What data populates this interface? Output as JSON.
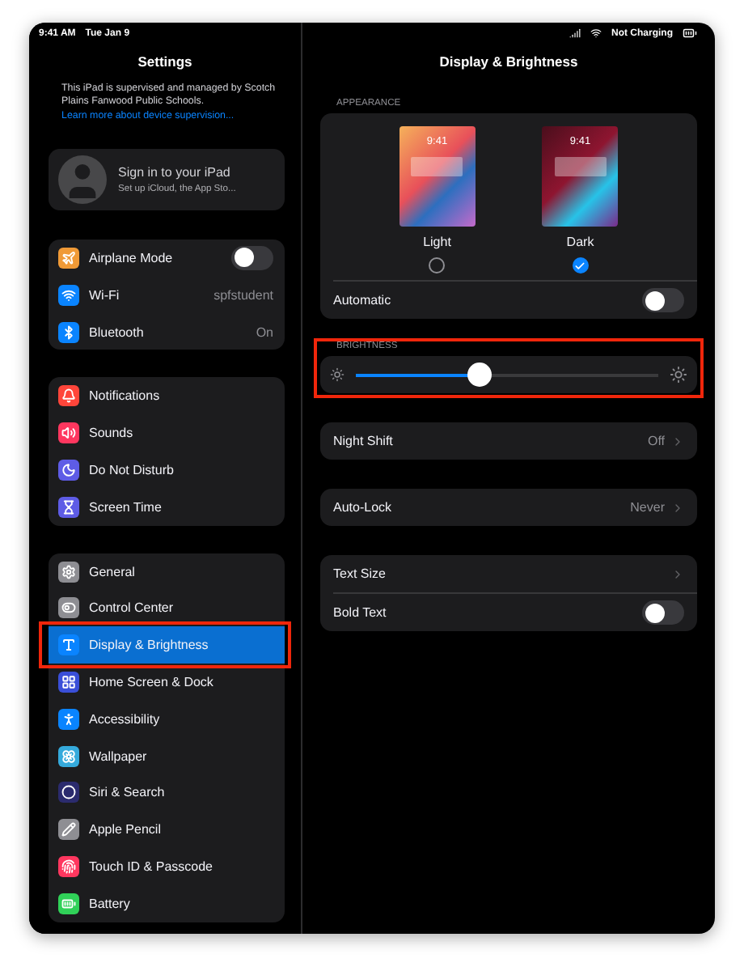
{
  "sidebar": {
    "status": {
      "time": "9:41 AM",
      "date": "Tue Jan 9"
    },
    "title": "Settings",
    "notice": "This iPad is supervised and managed by Scotch Plains Fanwood Public Schools.",
    "notice_link": "Learn more about device supervision...",
    "profile": {
      "title": "Sign in to your iPad",
      "subtitle": "Set up iCloud, the App Sto..."
    },
    "groups": [
      {
        "items": [
          {
            "label": "Airplane Mode",
            "kind": "toggle",
            "on": false,
            "selected": false,
            "highlighted": false,
            "color": "#f09a37"
          },
          {
            "label": "Wi-Fi",
            "kind": "value",
            "value": "spfstudent",
            "selected": false,
            "highlighted": false,
            "color": "#0a84ff"
          },
          {
            "label": "Bluetooth",
            "kind": "value",
            "value": "On",
            "selected": false,
            "highlighted": false,
            "color": "#0a84ff"
          }
        ]
      },
      {
        "items": [
          {
            "label": "Notifications",
            "kind": "plain",
            "selected": false,
            "highlighted": false,
            "color": "#ff453a"
          },
          {
            "label": "Sounds",
            "kind": "plain",
            "selected": false,
            "highlighted": false,
            "color": "#ff375f"
          },
          {
            "label": "Do Not Disturb",
            "kind": "plain",
            "selected": false,
            "highlighted": false,
            "color": "#5e5ce6"
          },
          {
            "label": "Screen Time",
            "kind": "plain",
            "selected": false,
            "highlighted": false,
            "color": "#5e5ce6"
          }
        ]
      },
      {
        "items": [
          {
            "label": "General",
            "kind": "plain",
            "selected": false,
            "highlighted": false,
            "color": "#8e8e93"
          },
          {
            "label": "Control Center",
            "kind": "plain",
            "selected": false,
            "highlighted": false,
            "color": "#8e8e93"
          },
          {
            "label": "Display & Brightness",
            "kind": "plain",
            "selected": true,
            "highlighted": true,
            "color": "#0a84ff"
          },
          {
            "label": "Home Screen & Dock",
            "kind": "plain",
            "selected": false,
            "highlighted": false,
            "color": "#3a4fd8"
          },
          {
            "label": "Accessibility",
            "kind": "plain",
            "selected": false,
            "highlighted": false,
            "color": "#0a84ff"
          },
          {
            "label": "Wallpaper",
            "kind": "plain",
            "selected": false,
            "highlighted": false,
            "color": "#35aadc"
          },
          {
            "label": "Siri & Search",
            "kind": "plain",
            "selected": false,
            "highlighted": false,
            "color": "#2b2b6e"
          },
          {
            "label": "Apple Pencil",
            "kind": "plain",
            "selected": false,
            "highlighted": false,
            "color": "#8e8e93"
          },
          {
            "label": "Touch ID & Passcode",
            "kind": "plain",
            "selected": false,
            "highlighted": false,
            "color": "#ff375f"
          },
          {
            "label": "Battery",
            "kind": "plain",
            "selected": false,
            "highlighted": false,
            "color": "#30d158"
          }
        ]
      }
    ]
  },
  "detail": {
    "status": {
      "charging": "Not Charging"
    },
    "title": "Display & Brightness",
    "appearance": {
      "header": "APPEARANCE",
      "options": [
        {
          "label": "Light",
          "time": "9:41",
          "kind": "light",
          "selected": false
        },
        {
          "label": "Dark",
          "time": "9:41",
          "kind": "dark",
          "selected": true
        }
      ],
      "automatic": {
        "label": "Automatic",
        "on": false
      }
    },
    "brightness": {
      "header": "BRIGHTNESS",
      "level": 0.41,
      "highlighted": true
    },
    "groups": [
      [
        {
          "label": "Night Shift",
          "kind": "link",
          "value": "Off"
        }
      ],
      [
        {
          "label": "Auto-Lock",
          "kind": "link",
          "value": "Never"
        }
      ],
      [
        {
          "label": "Text Size",
          "kind": "link"
        },
        {
          "label": "Bold Text",
          "kind": "toggle",
          "on": false
        }
      ]
    ]
  }
}
